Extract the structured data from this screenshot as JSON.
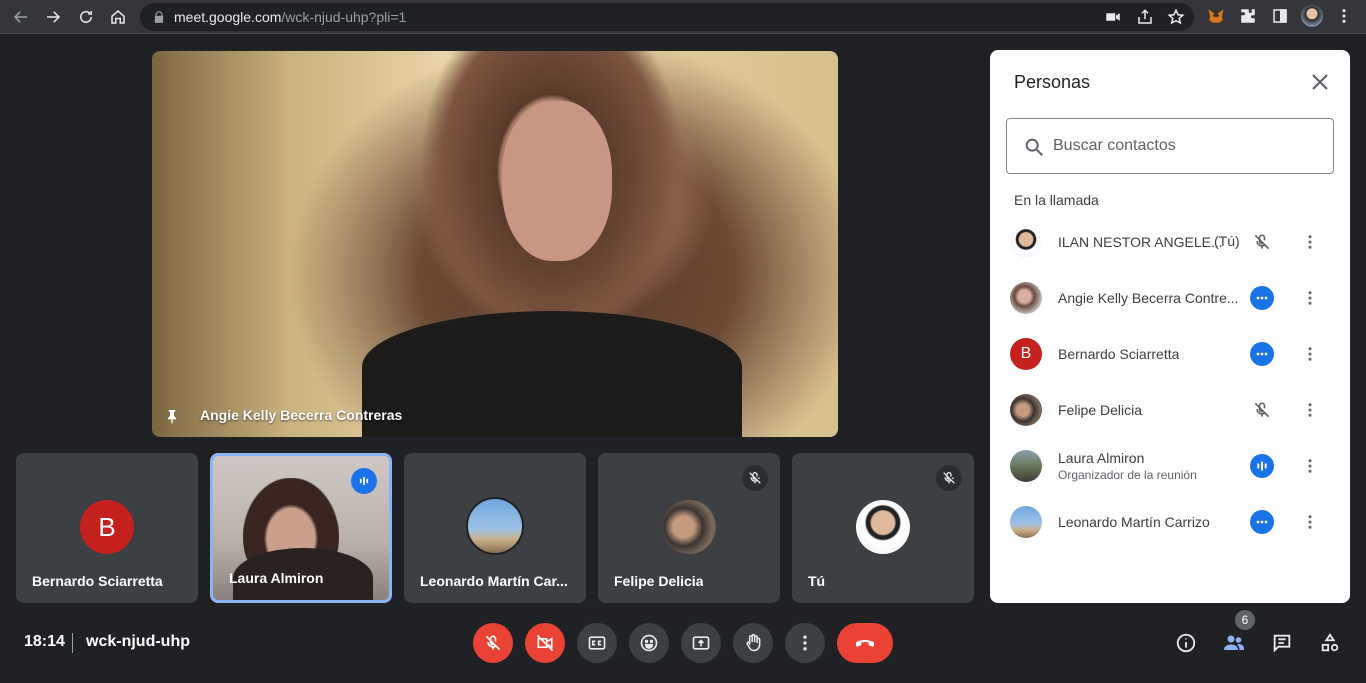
{
  "browser": {
    "url_host": "meet.google.com",
    "url_path": "/wck-njud-uhp?pli=1"
  },
  "main_video": {
    "participant_name": "Angie Kelly Becerra Contreras"
  },
  "tiles": [
    {
      "name": "Bernardo Sciarretta",
      "avatar_letter": "B",
      "state": "none"
    },
    {
      "name": "Laura Almiron",
      "state": "speaking"
    },
    {
      "name": "Leonardo Martín Car...",
      "state": "none"
    },
    {
      "name": "Felipe Delicia",
      "state": "muted"
    },
    {
      "name": "Tú",
      "state": "muted"
    }
  ],
  "people_panel": {
    "title": "Personas",
    "search_placeholder": "Buscar contactos",
    "section_label": "En la llamada",
    "participants": [
      {
        "name": "ILAN NESTOR ANGELE...",
        "suffix": "(Tú)",
        "status": "muted"
      },
      {
        "name": "Angie Kelly Becerra Contre...",
        "status": "ellipsis-blue"
      },
      {
        "name": "Bernardo Sciarretta",
        "avatar_letter": "B",
        "status": "ellipsis-blue"
      },
      {
        "name": "Felipe Delicia",
        "status": "muted"
      },
      {
        "name": "Laura Almiron",
        "subtitle": "Organizador de la reunión",
        "status": "speaking"
      },
      {
        "name": "Leonardo Martín Carrizo",
        "status": "ellipsis-blue"
      }
    ]
  },
  "bottom_bar": {
    "time": "18:14",
    "meeting_code": "wck-njud-uhp",
    "people_count": "6"
  },
  "colors": {
    "background": "#202124",
    "danger": "#ea4335",
    "accent": "#1a73e8"
  }
}
